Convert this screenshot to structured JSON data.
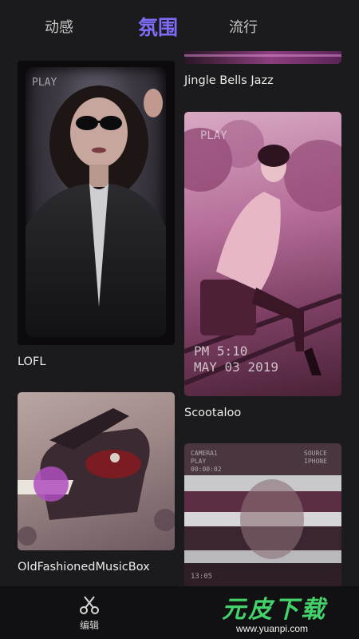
{
  "tabs": [
    {
      "label": "动感",
      "active": false
    },
    {
      "label": "氛围",
      "active": true
    },
    {
      "label": "流行",
      "active": false
    }
  ],
  "accent_color": "#7d6cf6",
  "cards": {
    "jingle": {
      "title": "Jingle Bells Jazz"
    },
    "lofl": {
      "title": "LOFL",
      "overlay": "PLAY"
    },
    "scootaloo": {
      "title": "Scootaloo",
      "overlay_play": "PLAY",
      "overlay_pm": "PM 5:10",
      "overlay_date": "MAY 03 2019"
    },
    "music": {
      "title": "OldFashionedMusicBox"
    },
    "glitch": {
      "camera": "CAMERA1",
      "play": "PLAY",
      "time": "00:00:02",
      "source": "SOURCE",
      "device": "IPHONE",
      "clock": "13:05"
    }
  },
  "bottom_nav": {
    "edit_label": "编辑",
    "edit_icon": "scissors-icon"
  },
  "watermark": {
    "text": "元皮下载",
    "url": "www.yuanpi.com"
  }
}
